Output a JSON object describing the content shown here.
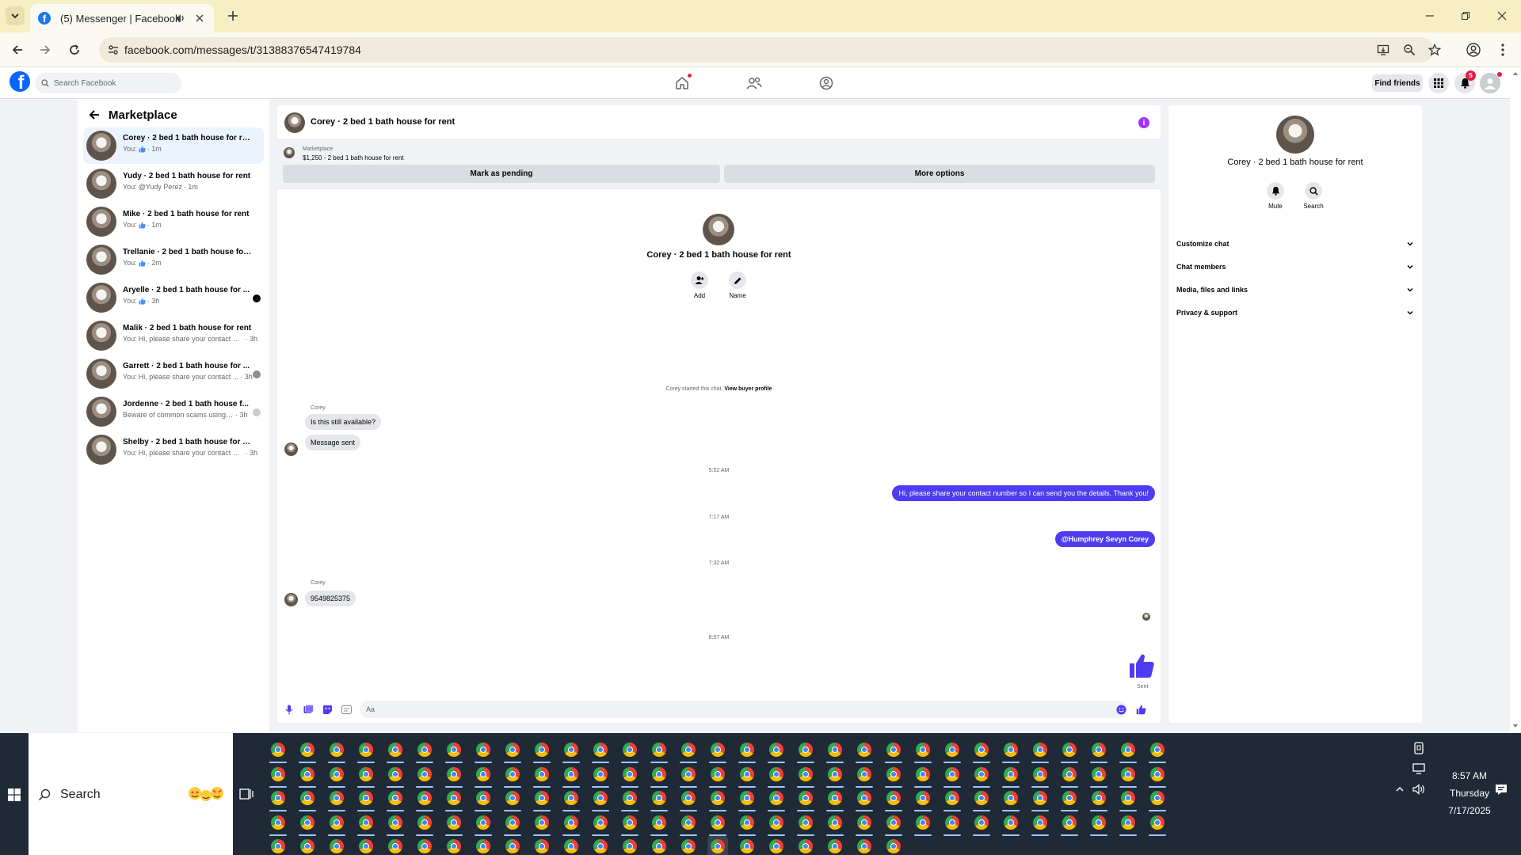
{
  "browser": {
    "tab_title": "(5) Messenger | Facebook",
    "url": "facebook.com/messages/t/31388376547419784"
  },
  "facebook": {
    "search_placeholder": "Search Facebook",
    "find_friends_label": "Find friends",
    "notification_count": "5"
  },
  "left_panel": {
    "title": "Marketplace",
    "conversations": [
      {
        "name": "Corey · 2 bed 1 bath house for rent",
        "prefix": "You:",
        "preview": "",
        "time": "· 1m",
        "like": true,
        "active": true
      },
      {
        "name": "Yudy · 2 bed 1 bath house for rent",
        "prefix": "You:",
        "preview": "@Yudy Perez",
        "time": "· 1m",
        "like": false,
        "active": false
      },
      {
        "name": "Mike · 2 bed 1 bath house for rent",
        "prefix": "You:",
        "preview": "",
        "time": "· 1m",
        "like": true,
        "active": false
      },
      {
        "name": "Trellanie · 2 bed 1 bath house for r...",
        "prefix": "You:",
        "preview": "",
        "time": "· 2m",
        "like": true,
        "active": false
      },
      {
        "name": "Aryelle · 2 bed 1 bath house for ...",
        "prefix": "You:",
        "preview": "",
        "time": "· 3h",
        "like": true,
        "active": false
      },
      {
        "name": "Malik · 2 bed 1 bath house for rent",
        "prefix": "You:",
        "preview": "Hi, please share your contact nu...",
        "time": "· 3h",
        "like": false,
        "active": false
      },
      {
        "name": "Garrett · 2 bed 1 bath house for ...",
        "prefix": "You:",
        "preview": "Hi, please share your contact ...",
        "time": "· 3h",
        "like": false,
        "active": false
      },
      {
        "name": "Jordenne · 2 bed 1 bath house f...",
        "prefix": "",
        "preview": "Beware of common scams using p...",
        "time": "· 3h",
        "like": false,
        "active": false
      },
      {
        "name": "Shelby · 2 bed 1 bath house for rent",
        "prefix": "You:",
        "preview": "Hi, please share your contact nu...",
        "time": "· 3h",
        "like": false,
        "active": false
      }
    ]
  },
  "chat": {
    "header_title": "Corey · 2 bed 1 bath house for rent",
    "listing_label": "Marketplace",
    "listing_title": "$1,250 - 2 bed 1 bath house for rent",
    "mark_pending_label": "Mark as pending",
    "more_options_label": "More options",
    "profile_name": "Corey · 2 bed 1 bath house for rent",
    "add_label": "Add",
    "name_label": "Name",
    "started_text": "Corey started this chat.",
    "view_buyer_profile": "View buyer profile",
    "sender_1": "Corey",
    "msg_1": "Is this still available?",
    "msg_2": "Message sent",
    "time_1": "5:52 AM",
    "msg_out_1": "Hi, please share your contact number so I can send you the details. Thank you!",
    "time_2": "7:17 AM",
    "msg_out_2": "@Humphrey Sevyn Corey",
    "time_3": "7:32 AM",
    "sender_2": "Corey",
    "msg_3": "9549825375",
    "time_4": "8:57 AM",
    "sent_label": "Sent",
    "composer_placeholder": "Aa"
  },
  "right_panel": {
    "name": "Corey · 2 bed 1 bath house for rent",
    "mute_label": "Mute",
    "search_label": "Search",
    "sections": [
      "Customize chat",
      "Chat members",
      "Media, files and links",
      "Privacy & support"
    ]
  },
  "taskbar": {
    "search_label": "Search",
    "time": "8:57 AM",
    "day": "Thursday",
    "date": "7/17/2025"
  },
  "colors": {
    "accent": "#4d3cf1",
    "facebook_blue": "#0866ff",
    "taskbar": "#1f2a36",
    "tab_bar": "#f6efc3"
  }
}
